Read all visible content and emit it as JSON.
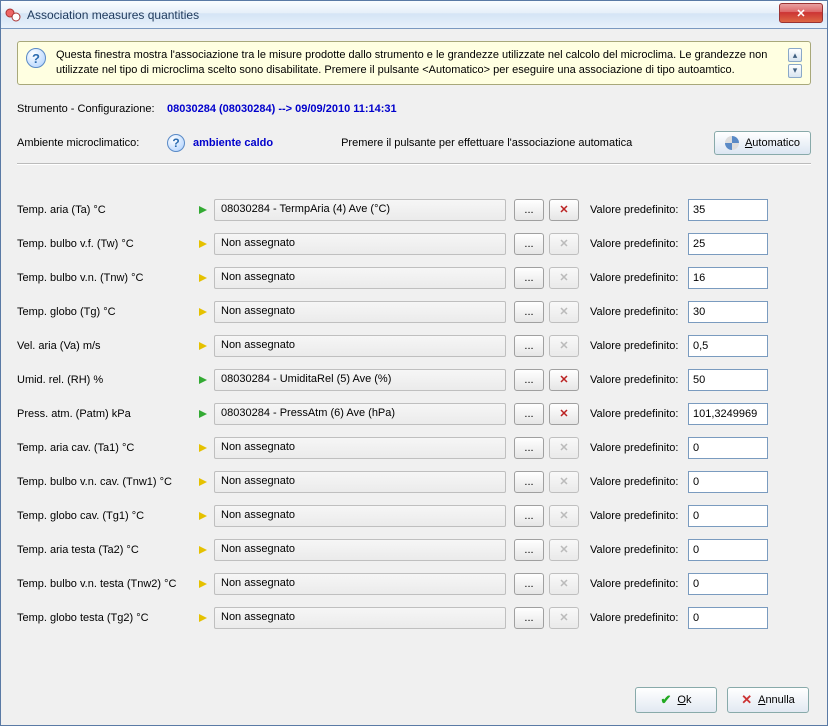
{
  "window": {
    "title": "Association measures quantities"
  },
  "info": {
    "text": "Questa finestra mostra l'associazione tra le misure prodotte dallo strumento e le grandezze utilizzate nel calcolo del microclima. Le grandezze non utilizzate nel tipo di microclima scelto sono disabilitate. Premere il pulsante <Automatico> per eseguire una associazione di tipo autoamtico."
  },
  "instrument": {
    "label": "Strumento - Configurazione:",
    "value": "08030284 (08030284) --> 09/09/2010 11:14:31"
  },
  "ambient": {
    "label": "Ambiente microclimatico:",
    "value": "ambiente caldo",
    "hint": "Premere il pulsante per effettuare l'associazione automatica",
    "auto_button": "Automatico"
  },
  "default_label": "Valore predefinito:",
  "browse_label": "...",
  "rows": [
    {
      "label": "Temp. aria (Ta) °C",
      "flag": "green",
      "assigned": "08030284 - TermpAria (4) Ave (°C)",
      "deletable": true,
      "default": "35"
    },
    {
      "label": "Temp. bulbo v.f. (Tw) °C",
      "flag": "yellow",
      "assigned": "Non assegnato",
      "deletable": false,
      "default": "25"
    },
    {
      "label": "Temp. bulbo v.n. (Tnw) °C",
      "flag": "yellow",
      "assigned": "Non assegnato",
      "deletable": false,
      "default": "16"
    },
    {
      "label": "Temp. globo (Tg) °C",
      "flag": "yellow",
      "assigned": "Non assegnato",
      "deletable": false,
      "default": "30"
    },
    {
      "label": "Vel. aria (Va) m/s",
      "flag": "yellow",
      "assigned": "Non assegnato",
      "deletable": false,
      "default": "0,5"
    },
    {
      "label": "Umid. rel. (RH) %",
      "flag": "green",
      "assigned": "08030284 - UmiditaRel (5) Ave (%)",
      "deletable": true,
      "default": "50"
    },
    {
      "label": "Press. atm. (Patm) kPa",
      "flag": "green",
      "assigned": "08030284 - PressAtm (6) Ave (hPa)",
      "deletable": true,
      "default": "101,3249969"
    },
    {
      "label": "Temp. aria cav. (Ta1) °C",
      "flag": "yellow",
      "assigned": "Non assegnato",
      "deletable": false,
      "default": "0"
    },
    {
      "label": "Temp. bulbo v.n. cav. (Tnw1) °C",
      "flag": "yellow",
      "assigned": "Non assegnato",
      "deletable": false,
      "default": "0"
    },
    {
      "label": "Temp. globo cav. (Tg1) °C",
      "flag": "yellow",
      "assigned": "Non assegnato",
      "deletable": false,
      "default": "0"
    },
    {
      "label": "Temp. aria testa (Ta2) °C",
      "flag": "yellow",
      "assigned": "Non assegnato",
      "deletable": false,
      "default": "0"
    },
    {
      "label": "Temp. bulbo v.n. testa (Tnw2) °C",
      "flag": "yellow",
      "assigned": "Non assegnato",
      "deletable": false,
      "default": "0"
    },
    {
      "label": "Temp. globo testa (Tg2) °C",
      "flag": "yellow",
      "assigned": "Non assegnato",
      "deletable": false,
      "default": "0"
    }
  ],
  "buttons": {
    "ok": "Ok",
    "cancel": "Annulla"
  }
}
